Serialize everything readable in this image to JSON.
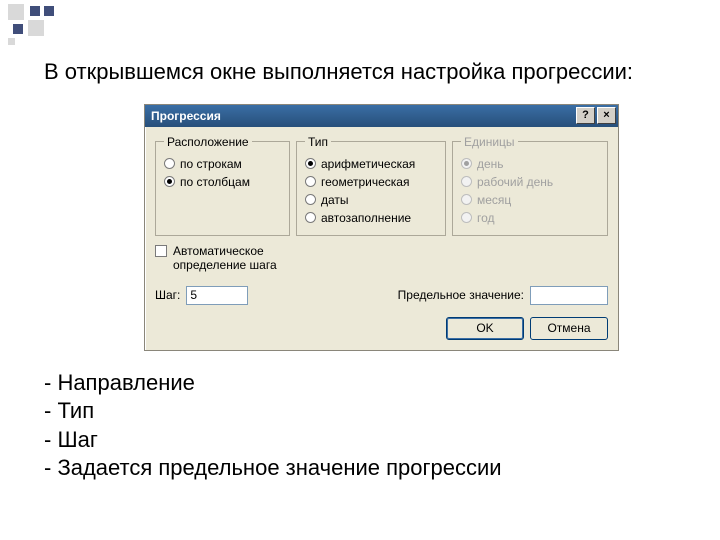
{
  "slide": {
    "lead": "В открывшемся окне выполняется настройка прогрессии:",
    "bullets": [
      " - Направление",
      " - Тип",
      " - Шаг",
      " - Задается предельное значение прогрессии"
    ]
  },
  "dialog": {
    "title": "Прогрессия",
    "help_btn": "?",
    "close_btn": "×",
    "groups": {
      "location": {
        "legend": "Расположение",
        "options": [
          "по строкам",
          "по столбцам"
        ],
        "selected": 1
      },
      "type": {
        "legend": "Тип",
        "options": [
          "арифметическая",
          "геометрическая",
          "даты",
          "автозаполнение"
        ],
        "selected": 0
      },
      "units": {
        "legend": "Единицы",
        "options": [
          "день",
          "рабочий день",
          "месяц",
          "год"
        ],
        "selected": 0,
        "disabled": true
      }
    },
    "checkbox": {
      "label": "Автоматическое определение шага"
    },
    "step": {
      "label": "Шаг:",
      "value": "5"
    },
    "limit": {
      "label": "Предельное значение:",
      "value": ""
    },
    "buttons": {
      "ok": "OK",
      "cancel": "Отмена"
    }
  }
}
